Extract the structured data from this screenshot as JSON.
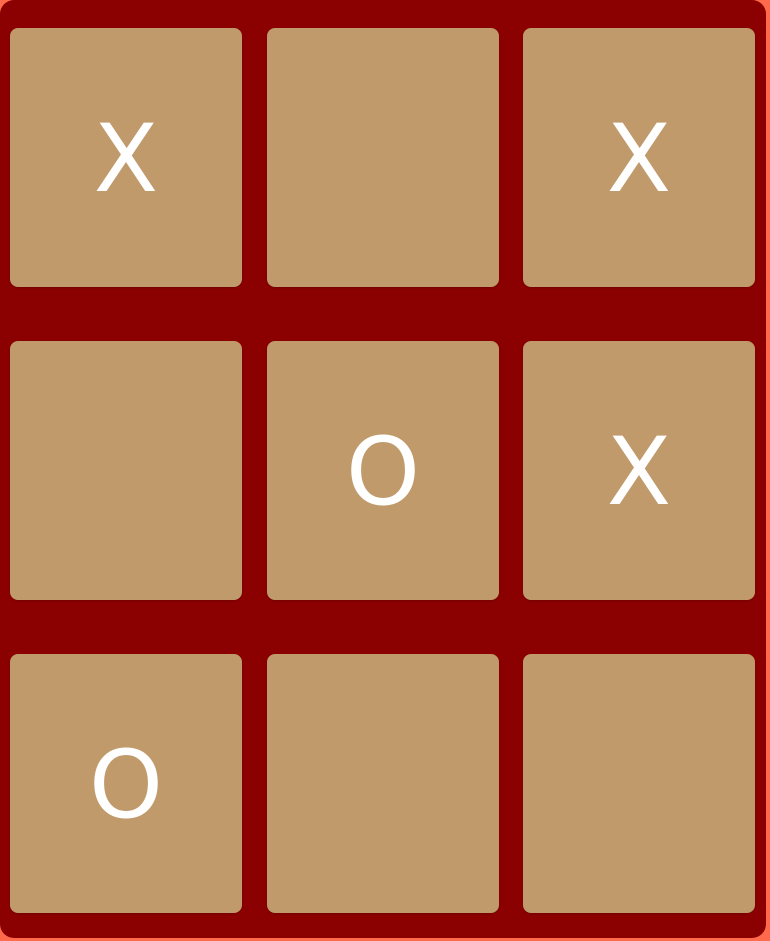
{
  "game": {
    "type": "tic-tac-toe",
    "colors": {
      "page_background": "#ff6a4d",
      "board_background": "#8b0000",
      "cell_background": "#c19a6b",
      "mark_color": "#ffffff"
    },
    "board": [
      [
        "X",
        "",
        "X"
      ],
      [
        "",
        "O",
        "X"
      ],
      [
        "O",
        "",
        ""
      ]
    ]
  }
}
